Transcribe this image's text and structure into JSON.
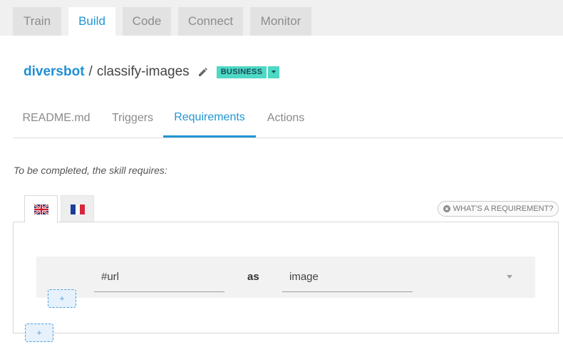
{
  "top_tabs": [
    {
      "label": "Train"
    },
    {
      "label": "Build",
      "active": true
    },
    {
      "label": "Code"
    },
    {
      "label": "Connect"
    },
    {
      "label": "Monitor"
    }
  ],
  "breadcrumb": {
    "owner": "diversbot",
    "separator": "/",
    "skill": "classify-images"
  },
  "plan_badge": {
    "label": "BUSINESS",
    "color": "#4dd9c3"
  },
  "sub_tabs": [
    {
      "label": "README.md"
    },
    {
      "label": "Triggers"
    },
    {
      "label": "Requirements",
      "active": true
    },
    {
      "label": "Actions"
    }
  ],
  "intro_text": "To be completed, the skill requires:",
  "languages": [
    {
      "flag": "uk-flag-icon",
      "active": true
    },
    {
      "flag": "france-flag-icon",
      "active": false
    }
  ],
  "help_button": {
    "icon": "info-circle-icon",
    "label": "WHAT'S A REQUIREMENT?"
  },
  "requirement": {
    "variable": "#url",
    "as_label": "as",
    "type": "image"
  },
  "add_buttons": {
    "inner": "+",
    "outer": "+"
  },
  "accent_color": "#2196d3"
}
